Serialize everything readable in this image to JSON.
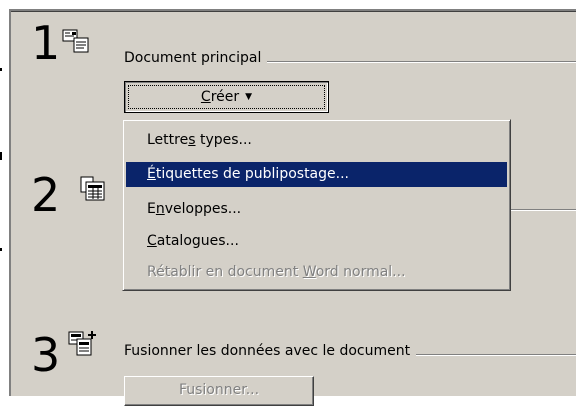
{
  "steps": [
    {
      "number": "1",
      "title": "Document principal",
      "icon": "main-document-icon"
    },
    {
      "number": "2",
      "title": "",
      "icon": "data-source-icon"
    },
    {
      "number": "3",
      "title": "Fusionner les données avec le document",
      "icon": "merge-icon"
    }
  ],
  "buttons": {
    "create": {
      "label_pre": "",
      "label_key": "C",
      "label_post": "réer"
    },
    "merge": {
      "label": "Fusionner..."
    }
  },
  "menu": {
    "items": [
      {
        "pre": "Lettre",
        "key": "s",
        "post": " types...",
        "state": "normal"
      },
      {
        "pre": "",
        "key": "É",
        "post": "tiquettes de publipostage...",
        "state": "selected"
      },
      {
        "pre": "E",
        "key": "n",
        "post": "veloppes...",
        "state": "normal"
      },
      {
        "pre": "",
        "key": "C",
        "post": "atalogues...",
        "state": "normal"
      },
      {
        "pre": "Rétablir en document ",
        "key": "W",
        "post": "ord normal...",
        "state": "disabled"
      }
    ]
  },
  "colors": {
    "dialog_bg": "#d4d0c8",
    "selection": "#0a246a"
  }
}
